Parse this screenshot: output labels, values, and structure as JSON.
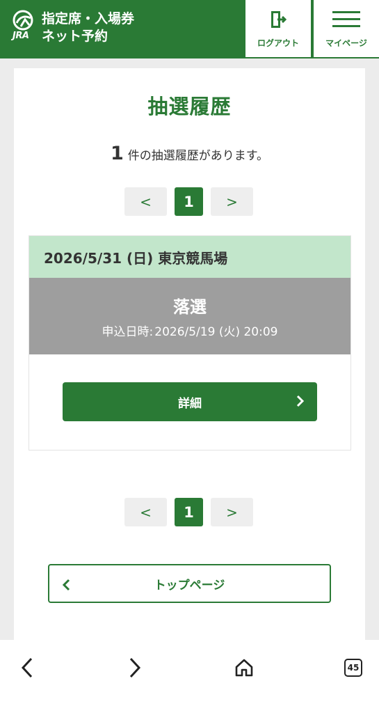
{
  "header": {
    "brand_line1": "指定席・入場券",
    "brand_line2": "ネット予約",
    "brand_logo_text": "JRA",
    "logout_label": "ログアウト",
    "mypage_label": "マイページ"
  },
  "page": {
    "title": "抽選履歴",
    "count_number": "1",
    "count_text": "件の抽選履歴があります。"
  },
  "pager": {
    "prev": "<",
    "current": "1",
    "next": ">"
  },
  "entries": [
    {
      "date_venue": "2026/5/31 (日) 東京競馬場",
      "result": "落選",
      "applied_label": "申込日時:",
      "applied_datetime": "2026/5/19 (火) 20:09",
      "detail_label": "詳細"
    }
  ],
  "footer": {
    "top_page_label": "トップページ"
  },
  "browser": {
    "tab_count": "45"
  },
  "colors": {
    "brand_green": "#2a7a35",
    "entry_header": "#c2e6cb",
    "status_gray": "#9e9e9e"
  },
  "icons": [
    "logo-icon",
    "logout-icon",
    "menu-icon",
    "chevron-right-icon",
    "chevron-left-icon",
    "back-icon",
    "forward-icon",
    "home-icon",
    "tabs-icon"
  ]
}
